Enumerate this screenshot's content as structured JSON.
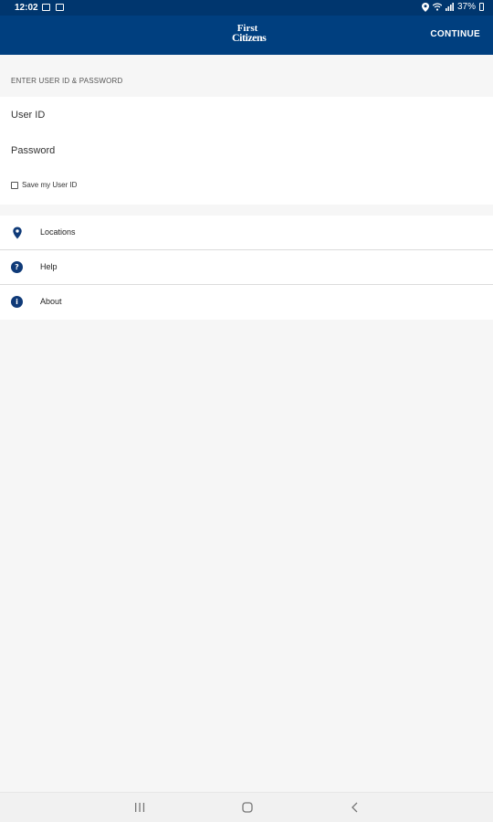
{
  "status_bar": {
    "time": "12:02",
    "battery": "37%",
    "left_icons": [
      "image-icon",
      "notification-icon"
    ],
    "right_icons": [
      "location-icon",
      "wifi-icon",
      "signal-icon",
      "battery-icon"
    ]
  },
  "app_bar": {
    "logo_line1": "First",
    "logo_line2": "Citizens",
    "continue_label": "CONTINUE",
    "background_color": "#003f7f"
  },
  "login": {
    "section_title": "ENTER USER ID & PASSWORD",
    "user_id_placeholder": "User ID",
    "password_placeholder": "Password",
    "save_label": "Save my User ID",
    "save_checked": false
  },
  "menu": {
    "items": [
      {
        "label": "Locations",
        "icon": "location-pin-icon"
      },
      {
        "label": "Help",
        "icon": "help-icon",
        "glyph": "?"
      },
      {
        "label": "About",
        "icon": "info-icon",
        "glyph": "i"
      }
    ]
  },
  "nav_bar": {
    "buttons": [
      "recent-apps-icon",
      "home-icon",
      "back-icon"
    ]
  }
}
